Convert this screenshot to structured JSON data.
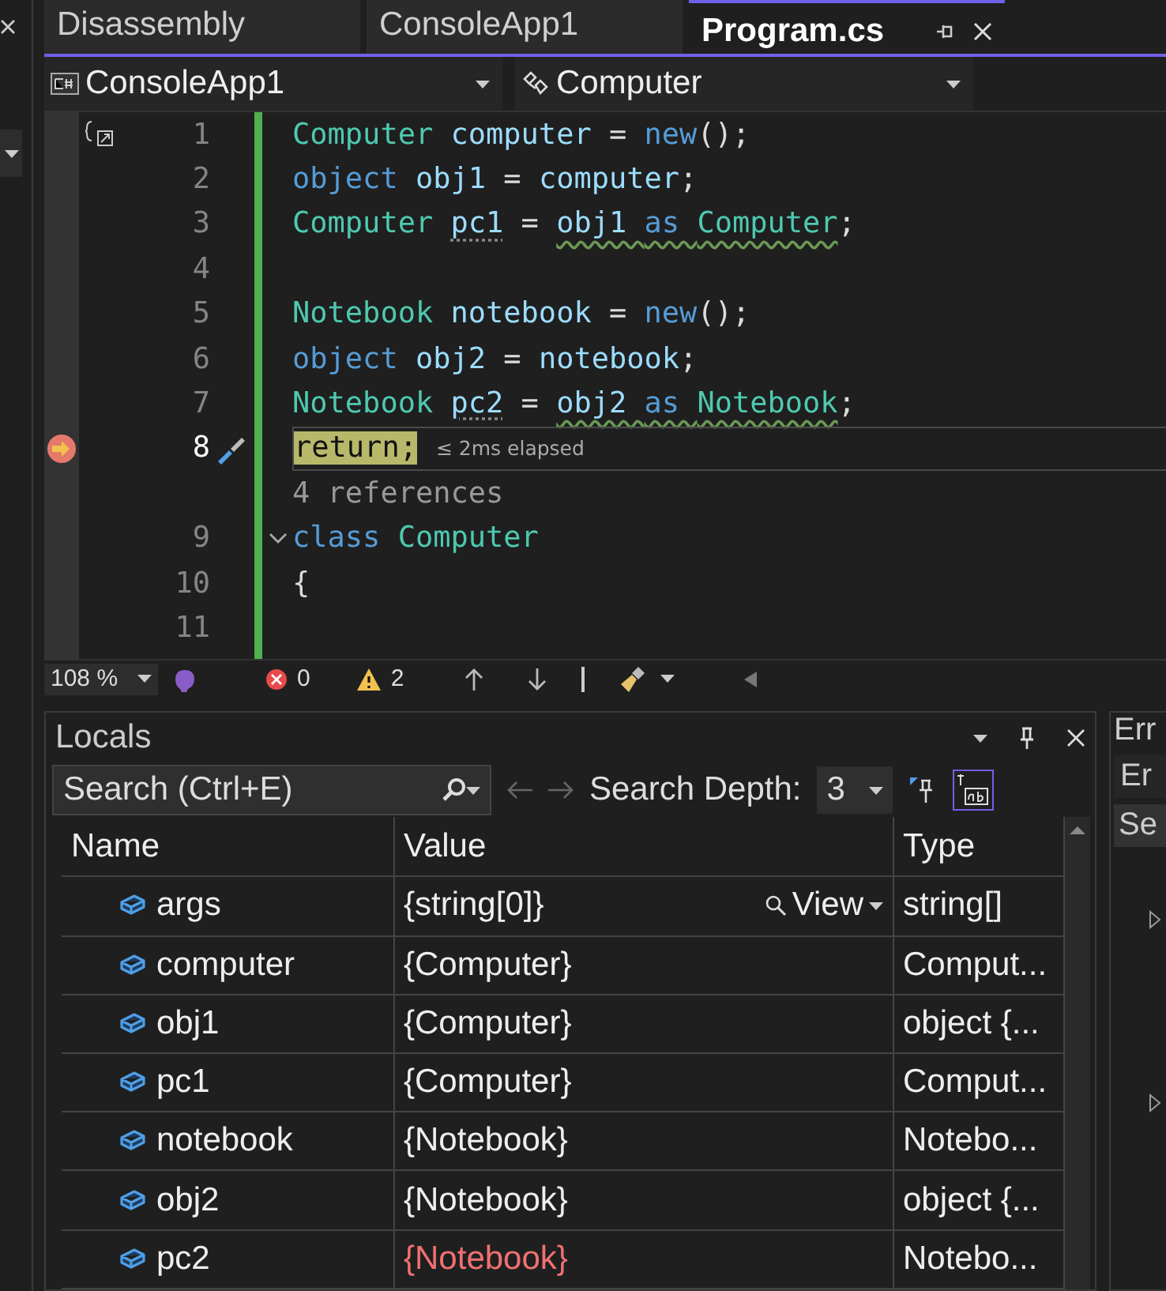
{
  "tabs": [
    {
      "label": "Disassembly",
      "selected": false
    },
    {
      "label": "ConsoleApp1",
      "selected": false
    },
    {
      "label": "Program.cs",
      "selected": true
    }
  ],
  "nav": {
    "project": "ConsoleApp1",
    "member": "Computer"
  },
  "code": [
    {
      "kind": "line",
      "number": "1",
      "tokens": [
        {
          "t": "Computer",
          "color": "#4ec9b0"
        },
        {
          "t": " computer",
          "color": "#9cdcfe"
        },
        {
          "t": " = ",
          "color": "#dcdcdc"
        },
        {
          "t": "new",
          "color": "#569cd6"
        },
        {
          "t": "();",
          "color": "#dcdcdc"
        }
      ]
    },
    {
      "kind": "line",
      "number": "2",
      "tokens": [
        {
          "t": "object",
          "color": "#569cd6"
        },
        {
          "t": " obj1",
          "color": "#9cdcfe"
        },
        {
          "t": " = ",
          "color": "#dcdcdc"
        },
        {
          "t": "computer",
          "color": "#9cdcfe"
        },
        {
          "t": ";",
          "color": "#dcdcdc"
        }
      ]
    },
    {
      "kind": "line",
      "number": "3",
      "tokens": [
        {
          "t": "Computer ",
          "color": "#4ec9b0"
        },
        {
          "t": "pc1",
          "color": "#9cdcfe",
          "dots": true
        },
        {
          "t": " = ",
          "color": "#dcdcdc"
        },
        {
          "t": "obj1 ",
          "color": "#9cdcfe",
          "squiggle": true
        },
        {
          "t": "as ",
          "color": "#569cd6",
          "squiggle": true
        },
        {
          "t": "Computer",
          "color": "#4ec9b0",
          "squiggle": true
        },
        {
          "t": ";",
          "color": "#dcdcdc"
        }
      ]
    },
    {
      "kind": "line",
      "number": "4"
    },
    {
      "kind": "line",
      "number": "5",
      "tokens": [
        {
          "t": "Notebook",
          "color": "#4ec9b0"
        },
        {
          "t": " notebook",
          "color": "#9cdcfe"
        },
        {
          "t": " = ",
          "color": "#dcdcdc"
        },
        {
          "t": "new",
          "color": "#569cd6"
        },
        {
          "t": "();",
          "color": "#dcdcdc"
        }
      ]
    },
    {
      "kind": "line",
      "number": "6",
      "tokens": [
        {
          "t": "object",
          "color": "#569cd6"
        },
        {
          "t": " obj2",
          "color": "#9cdcfe"
        },
        {
          "t": " = ",
          "color": "#dcdcdc"
        },
        {
          "t": "notebook",
          "color": "#9cdcfe"
        },
        {
          "t": ";",
          "color": "#dcdcdc"
        }
      ]
    },
    {
      "kind": "line",
      "number": "7",
      "tokens": [
        {
          "t": "Notebook ",
          "color": "#4ec9b0"
        },
        {
          "t": "pc2",
          "color": "#9cdcfe",
          "dots": true
        },
        {
          "t": " = ",
          "color": "#dcdcdc"
        },
        {
          "t": "obj2 ",
          "color": "#9cdcfe",
          "squiggle": true
        },
        {
          "t": "as ",
          "color": "#569cd6",
          "squiggle": true
        },
        {
          "t": "Notebook",
          "color": "#4ec9b0",
          "squiggle": true
        },
        {
          "t": ";",
          "color": "#dcdcdc"
        }
      ]
    },
    {
      "kind": "line",
      "number": "8",
      "current": true,
      "hint": "≤ 2ms elapsed",
      "tokens": [
        {
          "t": "return;"
        }
      ]
    },
    {
      "kind": "codelens",
      "text": "4 references"
    },
    {
      "kind": "line",
      "number": "9",
      "foldable": true,
      "tokens": [
        {
          "t": "class ",
          "color": "#569cd6"
        },
        {
          "t": "Computer",
          "color": "#4ec9b0"
        }
      ]
    },
    {
      "kind": "line",
      "number": "10",
      "tokens": [
        {
          "t": "{",
          "color": "#dcdcdc"
        }
      ]
    },
    {
      "kind": "line",
      "number": "11"
    }
  ],
  "status": {
    "zoom": "108 %",
    "errors": "0",
    "warnings": "2"
  },
  "locals": {
    "title": "Locals",
    "search_placeholder": "Search (Ctrl+E)",
    "depth_label": "Search Depth:",
    "depth": "3",
    "columns": [
      "Name",
      "Value",
      "Type"
    ],
    "view_button": "View",
    "rows": [
      {
        "name": "args",
        "value": "{string[0]}",
        "type": "string[]",
        "changed": false,
        "viewable": true
      },
      {
        "name": "computer",
        "value": "{Computer}",
        "type": "Comput...",
        "changed": false,
        "viewable": false
      },
      {
        "name": "obj1",
        "value": "{Computer}",
        "type": "object {...",
        "changed": false,
        "viewable": false
      },
      {
        "name": "pc1",
        "value": "{Computer}",
        "type": "Comput...",
        "changed": false,
        "viewable": false
      },
      {
        "name": "notebook",
        "value": "{Notebook}",
        "type": "Notebo...",
        "changed": false,
        "viewable": false
      },
      {
        "name": "obj2",
        "value": "{Notebook}",
        "type": "object {...",
        "changed": false,
        "viewable": false
      },
      {
        "name": "pc2",
        "value": "{Notebook}",
        "type": "Notebo...",
        "changed": true,
        "viewable": false
      }
    ]
  },
  "side_panel": {
    "title": "Err",
    "dropdown": "Er",
    "header": "Se"
  }
}
